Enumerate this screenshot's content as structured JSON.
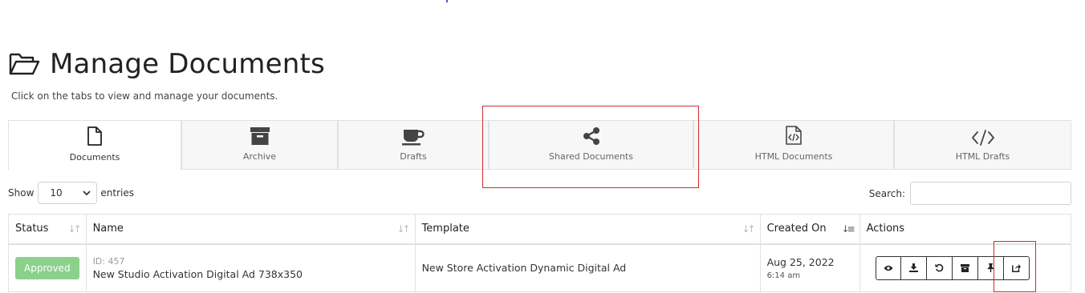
{
  "header": {
    "title": "Manage Documents",
    "subtitle": "Click on the tabs to view and manage your documents."
  },
  "tabs": [
    {
      "label": "Documents",
      "icon": "file-icon",
      "active": true
    },
    {
      "label": "Archive",
      "icon": "archive-box-icon",
      "active": false
    },
    {
      "label": "Drafts",
      "icon": "coffee-cup-icon",
      "active": false
    },
    {
      "label": "Shared Documents",
      "icon": "share-icon",
      "active": false
    },
    {
      "label": "HTML Documents",
      "icon": "code-file-icon",
      "active": false
    },
    {
      "label": "HTML Drafts",
      "icon": "code-icon",
      "active": false
    }
  ],
  "controls": {
    "show_label": "Show",
    "entries_value": "10",
    "entries_label": "entries",
    "search_label": "Search:"
  },
  "table": {
    "columns": [
      "Status",
      "Name",
      "Template",
      "Created On",
      "Actions"
    ],
    "rows": [
      {
        "status": "Approved",
        "id": "ID: 457",
        "name": "New Studio Activation Digital Ad 738x350",
        "template": "New Store Activation Dynamic Digital Ad",
        "date": "Aug 25, 2022",
        "time": "6:14 am"
      }
    ]
  },
  "actions": [
    "eye-icon",
    "download-icon",
    "undo-icon",
    "archive-icon",
    "pin-icon",
    "share-external-icon"
  ],
  "colors": {
    "highlight": "#d42b2b",
    "approved_badge": "#8bd08b"
  }
}
